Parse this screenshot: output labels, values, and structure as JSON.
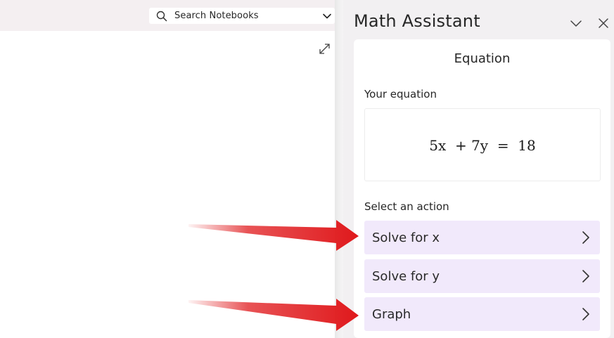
{
  "search": {
    "placeholder": "Search Notebooks"
  },
  "assistant": {
    "title": "Math Assistant",
    "card_title": "Equation",
    "equation_label": "Your equation",
    "equation": "5x  + 7y  =  18",
    "action_label": "Select an action",
    "actions": [
      {
        "label": "Solve for x"
      },
      {
        "label": "Solve for y"
      },
      {
        "label": "Graph"
      }
    ]
  },
  "icons": {
    "search": "search-icon",
    "dropdown": "chevron-down-icon",
    "expand": "expand-icon",
    "collapse": "chevron-down-icon",
    "close": "close-icon",
    "action_chevron": "chevron-right-icon",
    "annotation": "red-arrow-icon"
  },
  "colors": {
    "action_bg": "#f1e9fb",
    "annotation_arrow": "#e0191c",
    "panel_bg": "#f2f0f2"
  }
}
